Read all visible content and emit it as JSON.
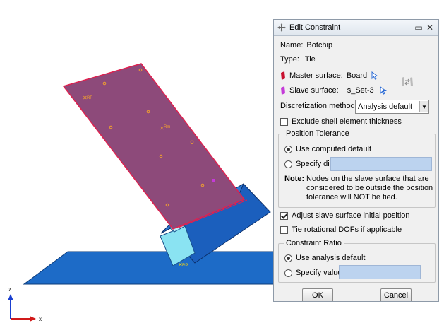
{
  "viewport": {
    "rp_labels": [
      "RP",
      "RP",
      "RP"
    ],
    "axis_labels": {
      "x": "x",
      "z": "z"
    },
    "colors": {
      "plate": "#8d4a7a",
      "plate_edge": "#e0214f",
      "board": "#1d6bc7",
      "chip": "#1b5fbd",
      "highlight": "#8ae3f2"
    }
  },
  "dialog": {
    "title": "Edit Constraint",
    "name_label": "Name:",
    "name_value": "Botchip",
    "type_label": "Type:",
    "type_value": "Tie",
    "master_label": "Master surface:",
    "master_value": "Board",
    "slave_label": "Slave surface:",
    "slave_value": "s_Set-3",
    "discretization_label": "Discretization method:",
    "discretization_value": "Analysis default",
    "exclude_shell_label": "Exclude shell element thickness",
    "exclude_shell_checked": false,
    "position_tolerance": {
      "title": "Position Tolerance",
      "use_computed_label": "Use computed default",
      "specify_distance_label": "Specify distance:",
      "selected": "use_computed",
      "note_label": "Note:",
      "note_text": [
        "Nodes on the slave surface that are",
        "considered to be outside the position",
        "tolerance will NOT be tied."
      ]
    },
    "adjust_label": "Adjust slave surface initial position",
    "adjust_checked": true,
    "tie_rot_label": "Tie rotational DOFs if applicable",
    "tie_rot_checked": false,
    "constraint_ratio": {
      "title": "Constraint Ratio",
      "use_default_label": "Use analysis default",
      "specify_value_label": "Specify value",
      "selected": "use_default"
    },
    "ok_label": "OK",
    "cancel_label": "Cancel"
  }
}
